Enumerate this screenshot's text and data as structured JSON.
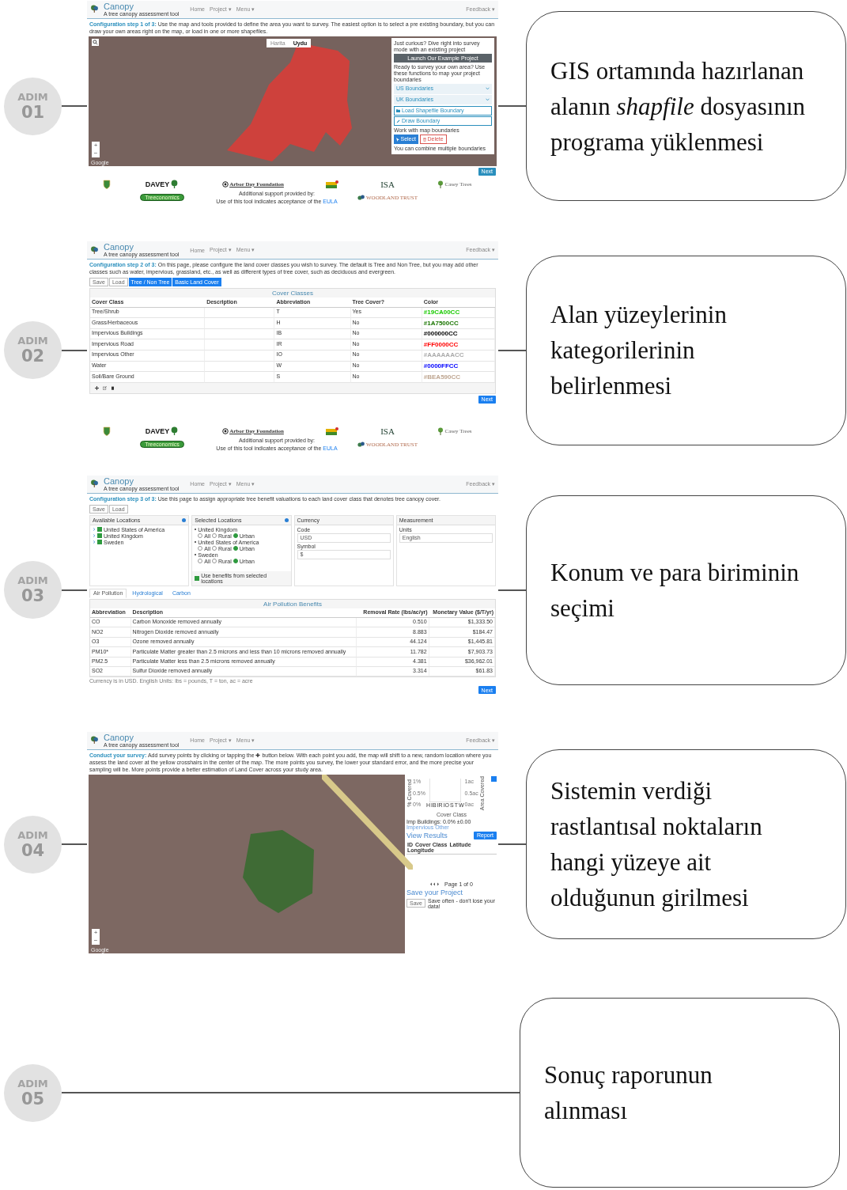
{
  "steps": [
    {
      "label": "ADIM",
      "number": "01",
      "caption": "GIS ortamında hazırlanan\nalanın *shapfile* dosyasının\nprograma yüklenmesi",
      "screen": {
        "kind": "boundary",
        "header": {
          "brand": "Canopy",
          "tagline": "A tree canopy assessment tool",
          "nav": [
            "Home",
            "Project ▾",
            "Menu ▾"
          ],
          "feedback": "Feedback ▾"
        },
        "intro": {
          "lead": "Configuration step 1 of 3:",
          "text": "Use the map and tools provided to define the area you want to survey. The easiest option is to select a pre existing boundary, but you can draw your own areas right on the map, or load in one or more shapefiles."
        },
        "map": {
          "types": [
            {
              "label": "Harita",
              "selected": false
            },
            {
              "label": "Uydu",
              "selected": true
            }
          ],
          "zoom": [
            "+",
            "−"
          ],
          "provider": "Google"
        },
        "panel": {
          "curious": "Just curious? Dive right into survey mode with an existing project",
          "example_button": "Launch Our Example Project",
          "ready": "Ready to survey your own area? Use these functions to map your project boundaries",
          "dropdowns": [
            "US Boundaries",
            "UK Boundaries"
          ],
          "load": "Load Shapefile Boundary",
          "draw": "Draw Boundary",
          "work": "Work with map boundaries",
          "select": "Select",
          "delete": "Delete",
          "combine": "You can combine multiple boundaries"
        },
        "next": "Next",
        "sponsors": {
          "logos": [
            {
              "kind": "shield"
            },
            {
              "kind": "davey",
              "text": "DAVEY"
            },
            {
              "kind": "arbor",
              "text": "Arbor Day Foundation"
            },
            {
              "kind": "colorful"
            },
            {
              "kind": "isa",
              "text": "ISA"
            },
            {
              "kind": "casey",
              "text": "Casey Trees"
            },
            {
              "kind": "treeconomics",
              "text": "Treeconomics"
            },
            {
              "kind": "woodland",
              "text": "WOODLAND TRUST"
            }
          ],
          "support": "Additional support provided by:",
          "eula_text": "Use of this tool indicates acceptance of the",
          "eula_link": "EULA"
        }
      }
    },
    {
      "label": "ADIM",
      "number": "02",
      "caption": "Alan yüzeylerinin\nkategorilerinin\nbelirlenmesi",
      "screen": {
        "kind": "classes",
        "header": {
          "brand": "Canopy",
          "tagline": "A tree canopy assessment tool",
          "nav": [
            "Home",
            "Project ▾",
            "Menu ▾"
          ],
          "feedback": "Feedback ▾"
        },
        "intro": {
          "lead": "Configuration step 2 of 3:",
          "text": "On this page, please configure the land cover classes you wish to survey. The default is Tree and Non Tree, but you may add other classes such as water, impervious, grassland, etc., as well as different types of tree cover, such as deciduous and evergreen."
        },
        "buttons": [
          "Save",
          "Load"
        ],
        "presets": [
          "Tree / Non Tree",
          "Basic Land Cover"
        ],
        "table": {
          "title": "Cover Classes",
          "columns": [
            "Cover Class",
            "Description",
            "Abbreviation",
            "Tree Cover?",
            "Color"
          ],
          "rows": [
            {
              "name": "Tree/Shrub",
              "abbreviation": "T",
              "tree_cover": "Yes",
              "code": "#19CA00CC",
              "color": "#19ca00"
            },
            {
              "name": "Grass/Herbaceous",
              "abbreviation": "H",
              "tree_cover": "No",
              "code": "#1A7500CC",
              "color": "#1a7500"
            },
            {
              "name": "Impervious Buildings",
              "abbreviation": "IB",
              "tree_cover": "No",
              "code": "#000000CC",
              "color": "#000000"
            },
            {
              "name": "Impervious Road",
              "abbreviation": "IR",
              "tree_cover": "No",
              "code": "#FF0000CC",
              "color": "#ff0000"
            },
            {
              "name": "Impervious Other",
              "abbreviation": "IO",
              "tree_cover": "No",
              "code": "#AAAAAACC",
              "color": "#aaaaaa"
            },
            {
              "name": "Water",
              "abbreviation": "W",
              "tree_cover": "No",
              "code": "#0000FFCC",
              "color": "#0000ff"
            },
            {
              "name": "Soil/Bare Ground",
              "abbreviation": "S",
              "tree_cover": "No",
              "code": "#BEA590CC",
              "color": "#bea590"
            }
          ]
        },
        "next": "Next",
        "sponsors": {
          "logos": [
            {
              "kind": "shield"
            },
            {
              "kind": "davey",
              "text": "DAVEY"
            },
            {
              "kind": "arbor",
              "text": "Arbor Day Foundation"
            },
            {
              "kind": "colorful"
            },
            {
              "kind": "isa",
              "text": "ISA"
            },
            {
              "kind": "casey",
              "text": "Casey Trees"
            },
            {
              "kind": "treeconomics",
              "text": "Treeconomics"
            },
            {
              "kind": "woodland",
              "text": "WOODLAND TRUST"
            }
          ],
          "support": "Additional support provided by:",
          "eula_text": "Use of this tool indicates acceptance of the",
          "eula_link": "EULA"
        }
      }
    },
    {
      "label": "ADIM",
      "number": "03",
      "caption": "Konum ve para biriminin\nseçimi",
      "screen": {
        "kind": "benefits",
        "header": {
          "brand": "Canopy",
          "tagline": "A tree canopy assessment tool",
          "nav": [
            "Home",
            "Project ▾",
            "Menu ▾"
          ],
          "feedback": "Feedback ▾"
        },
        "intro": {
          "lead": "Configuration step 3 of 3:",
          "text": "Use this page to assign appropriate tree benefit valuations to each land cover class that denotes tree canopy cover."
        },
        "buttons": [
          "Save",
          "Load"
        ],
        "available": {
          "title": "Available Locations",
          "items": [
            {
              "name": "United States of America",
              "checked": true
            },
            {
              "name": "United Kingdom",
              "checked": true
            },
            {
              "name": "Sweden",
              "checked": true
            }
          ]
        },
        "selected_locations": {
          "title": "Selected Locations",
          "items": [
            {
              "name": "United Kingdom",
              "options": [
                {
                  "label": "All",
                  "selected": false
                },
                {
                  "label": "Rural",
                  "selected": false
                },
                {
                  "label": "Urban",
                  "selected": true
                }
              ]
            },
            {
              "name": "United States of America",
              "options": [
                {
                  "label": "All",
                  "selected": false
                },
                {
                  "label": "Rural",
                  "selected": false
                },
                {
                  "label": "Urban",
                  "selected": true
                }
              ]
            },
            {
              "name": "Sweden",
              "options": [
                {
                  "label": "All",
                  "selected": false
                },
                {
                  "label": "Rural",
                  "selected": false
                },
                {
                  "label": "Urban",
                  "selected": true
                }
              ]
            }
          ],
          "use_benefits": {
            "label": "Use benefits from selected locations",
            "checked": true
          }
        },
        "currency": {
          "title": "Currency",
          "code_label": "Code",
          "code": "USD",
          "symbol_label": "Symbol",
          "symbol": "$"
        },
        "measurement": {
          "title": "Measurement",
          "units_label": "Units",
          "units": "English"
        },
        "tabs": [
          {
            "label": "Air Pollution",
            "selected": true
          },
          {
            "label": "Hydrological",
            "selected": false
          },
          {
            "label": "Carbon",
            "selected": false
          }
        ],
        "table": {
          "title": "Air Pollution Benefits",
          "columns": [
            "Abbreviation",
            "Description",
            "Removal Rate (lbs/ac/yr)",
            "Monetary Value ($/T/yr)"
          ],
          "rows": [
            [
              "CO",
              "Carbon Monoxide removed annually",
              "0.510",
              "$1,333.50"
            ],
            [
              "NO2",
              "Nitrogen Dioxide removed annually",
              "8.883",
              "$184.47"
            ],
            [
              "O3",
              "Ozone removed annually",
              "44.124",
              "$1,445.81"
            ],
            [
              "PM10*",
              "Particulate Matter greater than 2.5 microns and less than 10 microns removed annually",
              "11.782",
              "$7,903.73"
            ],
            [
              "PM2.5",
              "Particulate Matter less than 2.5 microns removed annually",
              "4.381",
              "$36,962.01"
            ],
            [
              "SO2",
              "Sulfur Dioxide removed annually",
              "3.314",
              "$61.83"
            ]
          ]
        },
        "note": "Currency is in USD. English Units: lbs = pounds, T = ton, ac = acre",
        "next": "Next"
      }
    },
    {
      "label": "ADIM",
      "number": "04",
      "caption": "Sistemin verdiği\nrastlantısal noktaların\nhangi yüzeye ait\nolduğunun girilmesi",
      "screen": {
        "kind": "survey",
        "header": {
          "brand": "Canopy",
          "tagline": "A tree canopy assessment tool",
          "nav": [
            "Home",
            "Project ▾",
            "Menu ▾"
          ],
          "feedback": "Feedback ▾"
        },
        "intro": {
          "lead": "Conduct your survey:",
          "text": "Add survey points by clicking or tapping the ✚ button below. With each point you add, the map will shift to a new, random location where you assess the land cover at the yellow crosshairs in the center of the map. The more points you survey, the lower your standard error, and the more precise your sampling will be. More points provide a better estimation of Land Cover across your study area."
        },
        "map": {
          "zoom": [
            "+",
            "−"
          ],
          "provider": "Google"
        },
        "chart": {
          "y_title": "% Covered",
          "y2_title": "Area Covered",
          "x_title": "Cover Class",
          "yticks": [
            "1%",
            "0.5%",
            "0%"
          ],
          "y2ticks": [
            "1ac",
            "0.5ac",
            "0ac"
          ],
          "categories": [
            "H",
            "IB",
            "IR",
            "IO",
            "S",
            "T",
            "W"
          ]
        },
        "legend": "Imp Buildings: 0.0% ±0.00",
        "legend_next": "Impervious Other",
        "results_title": "View Results",
        "report": "Report",
        "columns": [
          "ID",
          "Cover Class",
          "Latitude",
          "Longitude"
        ],
        "pager": "Page 1 of 0",
        "save_title": "Save your Project",
        "save": "Save",
        "save_hint": "Save often - don't lose your data!"
      }
    },
    {
      "label": "ADIM",
      "number": "05",
      "caption": "Sonuç raporunun\nalınması"
    }
  ]
}
